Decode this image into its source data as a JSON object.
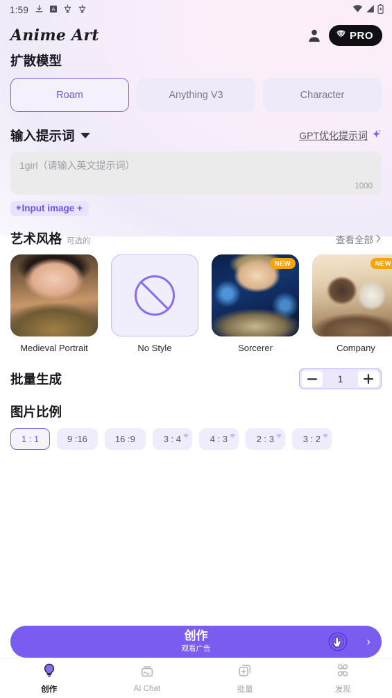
{
  "status_bar": {
    "time": "1:59",
    "left_icons": [
      "download-icon",
      "a-box-icon",
      "app-glyph-icon",
      "app-glyph-icon-2"
    ],
    "right_icons": [
      "wifi-icon",
      "signal-icon",
      "battery-icon"
    ]
  },
  "app_bar": {
    "brand": "Anime Art",
    "avatar_icon": "user-avatar-icon",
    "pro_label": "PRO",
    "pro_icon": "diamond-icon"
  },
  "model_section": {
    "title": "扩散模型",
    "options": [
      {
        "label": "Roam",
        "selected": true
      },
      {
        "label": "Anything V3",
        "selected": false
      },
      {
        "label": "Character",
        "selected": false
      }
    ]
  },
  "prompt_section": {
    "title": "输入提示词",
    "caret_icon": "chevron-down-icon",
    "gpt_link": "GPT优化提示词",
    "gpt_icon": "sparkle-icon",
    "placeholder": "1girl（请输入英文提示词）",
    "value": "",
    "char_limit": "1000",
    "input_image_label": "Input image +"
  },
  "style_section": {
    "title": "艺术风格",
    "subtitle": "可选的",
    "view_all": "查看全部",
    "view_all_icon": "chevron-right-icon",
    "cards": [
      {
        "label": "Medieval Portrait",
        "badge": "",
        "selected": false,
        "art": "art-medieval"
      },
      {
        "label": "No Style",
        "badge": "",
        "selected": true,
        "art": "no-style"
      },
      {
        "label": "Sorcerer",
        "badge": "NEW",
        "selected": false,
        "art": "art-sorcerer"
      },
      {
        "label": "Company",
        "badge": "NEW",
        "selected": false,
        "art": "art-company"
      }
    ]
  },
  "batch_section": {
    "title": "批量生成",
    "decrement_label": "−",
    "value": "1",
    "increment_label": "+"
  },
  "ratio_section": {
    "title": "图片比例",
    "options": [
      {
        "label": "1 : 1",
        "selected": true,
        "pro": false
      },
      {
        "label": "9 :16",
        "selected": false,
        "pro": false
      },
      {
        "label": "16 :9",
        "selected": false,
        "pro": false
      },
      {
        "label": "3 : 4",
        "selected": false,
        "pro": true
      },
      {
        "label": "4 : 3",
        "selected": false,
        "pro": true
      },
      {
        "label": "2 : 3",
        "selected": false,
        "pro": true
      },
      {
        "label": "3 : 2",
        "selected": false,
        "pro": true
      }
    ]
  },
  "cta": {
    "primary": "创作",
    "secondary": "观看广告",
    "chevron": "›"
  },
  "bottom_nav": {
    "items": [
      {
        "label": "创作",
        "icon": "lightbulb-icon",
        "active": true
      },
      {
        "label": "AI Chat",
        "icon": "chat-image-icon",
        "active": false
      },
      {
        "label": "批量",
        "icon": "add-card-icon",
        "active": false
      },
      {
        "label": "发现",
        "icon": "grid-clover-icon",
        "active": false
      }
    ]
  },
  "colors": {
    "accent": "#7b5cf0",
    "accent_text": "#6f52ee",
    "chip_bg": "#efecfb",
    "badge_new": "#f5a50b",
    "pro_bg": "#101014"
  }
}
